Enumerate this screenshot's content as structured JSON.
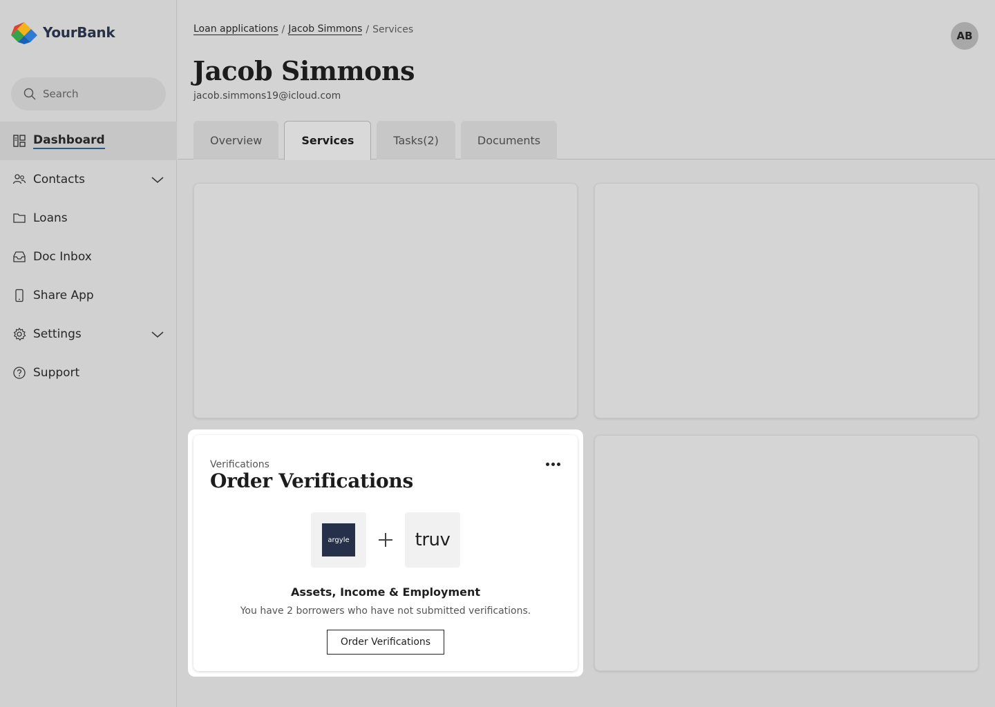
{
  "brand": {
    "name": "YourBank"
  },
  "sidebar": {
    "search_placeholder": "Search",
    "items": [
      {
        "label": "Dashboard",
        "icon": "dashboard-icon"
      },
      {
        "label": "Contacts",
        "icon": "contacts-icon"
      },
      {
        "label": "Loans",
        "icon": "folder-icon"
      },
      {
        "label": "Doc Inbox",
        "icon": "inbox-icon"
      },
      {
        "label": "Share App",
        "icon": "phone-icon"
      },
      {
        "label": "Settings",
        "icon": "gear-icon"
      },
      {
        "label": "Support",
        "icon": "help-icon"
      }
    ]
  },
  "breadcrumb": {
    "items": [
      "Loan applications",
      "Jacob Simmons",
      "Services"
    ],
    "separator": "/"
  },
  "user": {
    "initials": "AB"
  },
  "header": {
    "title": "Jacob Simmons",
    "email": "jacob.simmons19@icloud.com"
  },
  "tabs": [
    {
      "label": "Overview"
    },
    {
      "label": "Services"
    },
    {
      "label": "Tasks(2)"
    },
    {
      "label": "Documents"
    }
  ],
  "verification_card": {
    "kicker": "Verifications",
    "title": "Order Verifications",
    "partner_logos": [
      "argyle",
      "truv"
    ],
    "subheading": "Assets, Income & Employment",
    "description": "You have 2 borrowers who have not submitted verifications.",
    "button_label": "Order Verifications"
  },
  "colors": {
    "brand_text": "#27324a",
    "active_underline": "#2a5a8a",
    "argyle_bg": "#27304a"
  }
}
